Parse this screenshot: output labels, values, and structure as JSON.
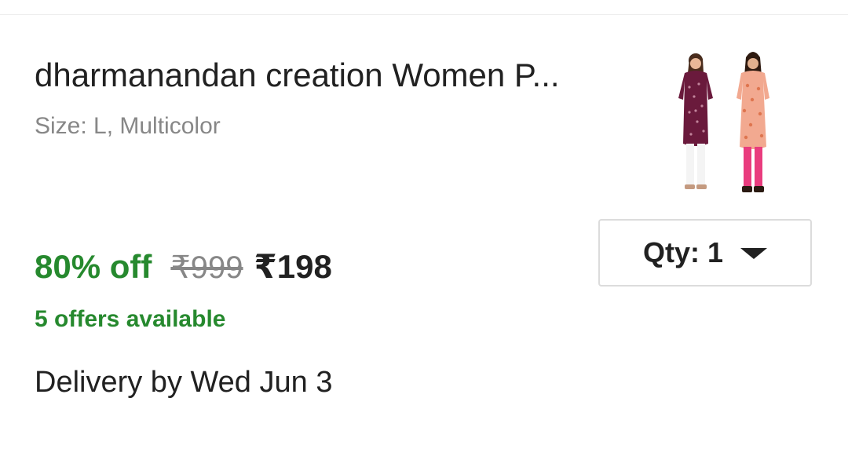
{
  "product": {
    "title": "dharmanandan creation Women P...",
    "variant": "Size: L, Multicolor",
    "image_icon": "kurta-product-image"
  },
  "pricing": {
    "discount": "80% off",
    "mrp": "₹999",
    "price": "₹198",
    "offers": "5 offers available"
  },
  "delivery": {
    "text": "Delivery by Wed Jun 3"
  },
  "quantity": {
    "label": "Qty: 1",
    "icon": "caret-down-icon"
  },
  "colors": {
    "green": "#26892e",
    "text_primary": "#212121",
    "text_secondary": "#878787"
  }
}
